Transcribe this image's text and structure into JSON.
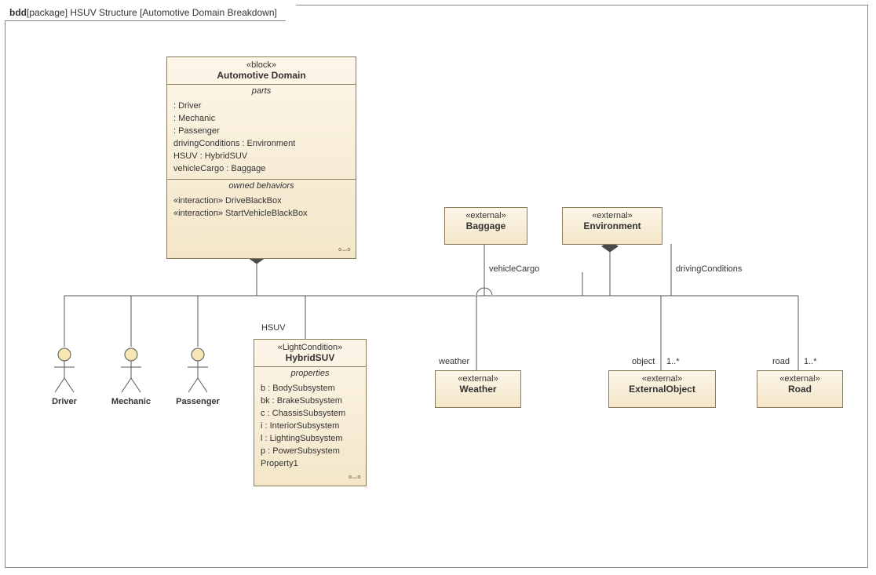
{
  "frame": {
    "kind": "bdd",
    "scope": "[package] HSUV Structure",
    "title": "[Automotive Domain Breakdown]"
  },
  "automotiveDomain": {
    "stereo": "«block»",
    "name": "Automotive Domain",
    "partsHeader": "parts",
    "parts": [
      ": Driver",
      ": Mechanic",
      ": Passenger",
      "drivingConditions : Environment",
      "HSUV : HybridSUV",
      "vehicleCargo : Baggage"
    ],
    "behHeader": "owned behaviors",
    "behaviors": [
      "«interaction» DriveBlackBox",
      "«interaction» StartVehicleBlackBox"
    ]
  },
  "baggage": {
    "stereo": "«external»",
    "name": "Baggage"
  },
  "environment": {
    "stereo": "«external»",
    "name": "Environment"
  },
  "hybridSUV": {
    "stereo": "«LightCondition»",
    "name": "HybridSUV",
    "propsHeader": "properties",
    "props": [
      "b : BodySubsystem",
      "bk : BrakeSubsystem",
      "c : ChassisSubsystem",
      "i : InteriorSubsystem",
      "l : LightingSubsystem",
      "p : PowerSubsystem",
      "Property1"
    ]
  },
  "weather": {
    "stereo": "«external»",
    "name": "Weather"
  },
  "externalObject": {
    "stereo": "«external»",
    "name": "ExternalObject"
  },
  "road": {
    "stereo": "«external»",
    "name": "Road"
  },
  "actors": {
    "driver": "Driver",
    "mechanic": "Mechanic",
    "passenger": "Passenger"
  },
  "roles": {
    "hsuv": "HSUV",
    "vehicleCargo": "vehicleCargo",
    "drivingConditions": "drivingConditions",
    "weather": "weather",
    "object": "object",
    "road": "road"
  },
  "mult": {
    "object": "1..*",
    "road": "1..*"
  }
}
